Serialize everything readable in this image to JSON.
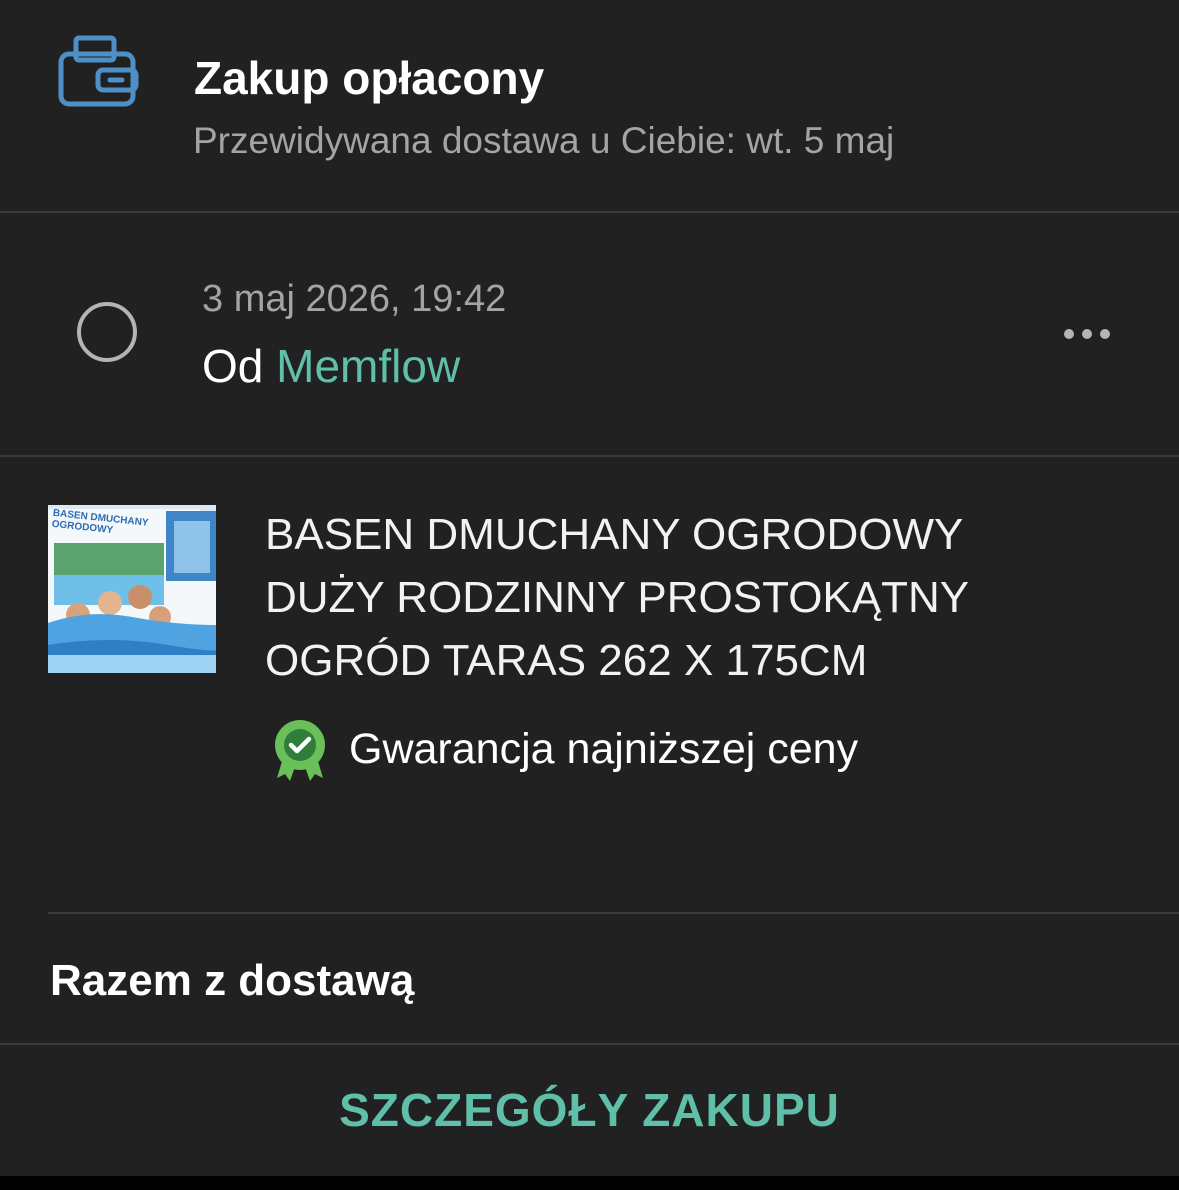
{
  "header": {
    "icon": "wallet-icon",
    "title": "Zakup opłacony",
    "subtitle": "Przewidywana dostawa u Ciebie: wt. 5 maj"
  },
  "order": {
    "date": "3 maj 2026, 19:42",
    "seller_prefix": "Od",
    "seller_name": "Memflow",
    "more_icon": "more-horizontal-icon",
    "seller_color": "#5fbfa9"
  },
  "product": {
    "image_text": "BASEN DMUCHANY OGRODOWY",
    "name": "BASEN DMUCHANY OGRODOWY DUŻY RODZINNY PROSTOKĄTNY OGRÓD TARAS 262 X 175CM",
    "badge_icon": "guarantee-badge-icon",
    "badge_text": "Gwarancja najniższej ceny",
    "badge_color": "#6bbf59"
  },
  "summary": {
    "total_label": "Razem z dostawą"
  },
  "footer": {
    "button_label": "SZCZEGÓŁY ZAKUPU",
    "accent_color": "#5fbfa9"
  }
}
